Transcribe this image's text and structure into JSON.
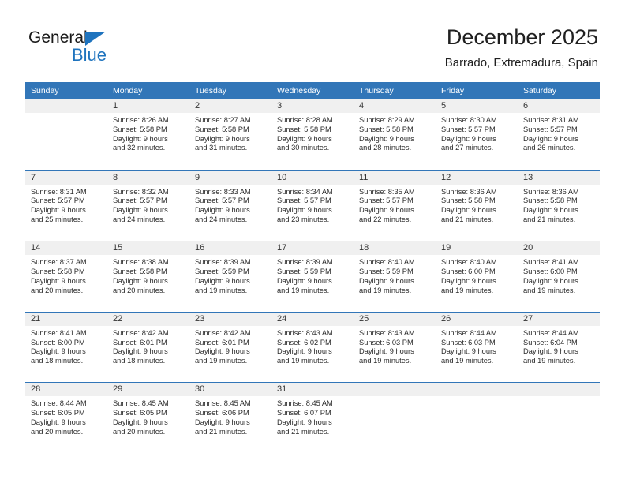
{
  "brand": {
    "name_top": "General",
    "name_bottom": "Blue",
    "accent_color": "#1e73be"
  },
  "header": {
    "title": "December 2025",
    "subtitle": "Barrado, Extremadura, Spain"
  },
  "theme": {
    "header_row_color": "#3276b8",
    "daynum_band_color": "#f0f0f0",
    "text_color": "#2b2b2b"
  },
  "weekdays": [
    "Sunday",
    "Monday",
    "Tuesday",
    "Wednesday",
    "Thursday",
    "Friday",
    "Saturday"
  ],
  "weeks": [
    [
      {
        "day": "",
        "lines": []
      },
      {
        "day": "1",
        "lines": [
          "Sunrise: 8:26 AM",
          "Sunset: 5:58 PM",
          "Daylight: 9 hours",
          "and 32 minutes."
        ]
      },
      {
        "day": "2",
        "lines": [
          "Sunrise: 8:27 AM",
          "Sunset: 5:58 PM",
          "Daylight: 9 hours",
          "and 31 minutes."
        ]
      },
      {
        "day": "3",
        "lines": [
          "Sunrise: 8:28 AM",
          "Sunset: 5:58 PM",
          "Daylight: 9 hours",
          "and 30 minutes."
        ]
      },
      {
        "day": "4",
        "lines": [
          "Sunrise: 8:29 AM",
          "Sunset: 5:58 PM",
          "Daylight: 9 hours",
          "and 28 minutes."
        ]
      },
      {
        "day": "5",
        "lines": [
          "Sunrise: 8:30 AM",
          "Sunset: 5:57 PM",
          "Daylight: 9 hours",
          "and 27 minutes."
        ]
      },
      {
        "day": "6",
        "lines": [
          "Sunrise: 8:31 AM",
          "Sunset: 5:57 PM",
          "Daylight: 9 hours",
          "and 26 minutes."
        ]
      }
    ],
    [
      {
        "day": "7",
        "lines": [
          "Sunrise: 8:31 AM",
          "Sunset: 5:57 PM",
          "Daylight: 9 hours",
          "and 25 minutes."
        ]
      },
      {
        "day": "8",
        "lines": [
          "Sunrise: 8:32 AM",
          "Sunset: 5:57 PM",
          "Daylight: 9 hours",
          "and 24 minutes."
        ]
      },
      {
        "day": "9",
        "lines": [
          "Sunrise: 8:33 AM",
          "Sunset: 5:57 PM",
          "Daylight: 9 hours",
          "and 24 minutes."
        ]
      },
      {
        "day": "10",
        "lines": [
          "Sunrise: 8:34 AM",
          "Sunset: 5:57 PM",
          "Daylight: 9 hours",
          "and 23 minutes."
        ]
      },
      {
        "day": "11",
        "lines": [
          "Sunrise: 8:35 AM",
          "Sunset: 5:57 PM",
          "Daylight: 9 hours",
          "and 22 minutes."
        ]
      },
      {
        "day": "12",
        "lines": [
          "Sunrise: 8:36 AM",
          "Sunset: 5:58 PM",
          "Daylight: 9 hours",
          "and 21 minutes."
        ]
      },
      {
        "day": "13",
        "lines": [
          "Sunrise: 8:36 AM",
          "Sunset: 5:58 PM",
          "Daylight: 9 hours",
          "and 21 minutes."
        ]
      }
    ],
    [
      {
        "day": "14",
        "lines": [
          "Sunrise: 8:37 AM",
          "Sunset: 5:58 PM",
          "Daylight: 9 hours",
          "and 20 minutes."
        ]
      },
      {
        "day": "15",
        "lines": [
          "Sunrise: 8:38 AM",
          "Sunset: 5:58 PM",
          "Daylight: 9 hours",
          "and 20 minutes."
        ]
      },
      {
        "day": "16",
        "lines": [
          "Sunrise: 8:39 AM",
          "Sunset: 5:59 PM",
          "Daylight: 9 hours",
          "and 19 minutes."
        ]
      },
      {
        "day": "17",
        "lines": [
          "Sunrise: 8:39 AM",
          "Sunset: 5:59 PM",
          "Daylight: 9 hours",
          "and 19 minutes."
        ]
      },
      {
        "day": "18",
        "lines": [
          "Sunrise: 8:40 AM",
          "Sunset: 5:59 PM",
          "Daylight: 9 hours",
          "and 19 minutes."
        ]
      },
      {
        "day": "19",
        "lines": [
          "Sunrise: 8:40 AM",
          "Sunset: 6:00 PM",
          "Daylight: 9 hours",
          "and 19 minutes."
        ]
      },
      {
        "day": "20",
        "lines": [
          "Sunrise: 8:41 AM",
          "Sunset: 6:00 PM",
          "Daylight: 9 hours",
          "and 19 minutes."
        ]
      }
    ],
    [
      {
        "day": "21",
        "lines": [
          "Sunrise: 8:41 AM",
          "Sunset: 6:00 PM",
          "Daylight: 9 hours",
          "and 18 minutes."
        ]
      },
      {
        "day": "22",
        "lines": [
          "Sunrise: 8:42 AM",
          "Sunset: 6:01 PM",
          "Daylight: 9 hours",
          "and 18 minutes."
        ]
      },
      {
        "day": "23",
        "lines": [
          "Sunrise: 8:42 AM",
          "Sunset: 6:01 PM",
          "Daylight: 9 hours",
          "and 19 minutes."
        ]
      },
      {
        "day": "24",
        "lines": [
          "Sunrise: 8:43 AM",
          "Sunset: 6:02 PM",
          "Daylight: 9 hours",
          "and 19 minutes."
        ]
      },
      {
        "day": "25",
        "lines": [
          "Sunrise: 8:43 AM",
          "Sunset: 6:03 PM",
          "Daylight: 9 hours",
          "and 19 minutes."
        ]
      },
      {
        "day": "26",
        "lines": [
          "Sunrise: 8:44 AM",
          "Sunset: 6:03 PM",
          "Daylight: 9 hours",
          "and 19 minutes."
        ]
      },
      {
        "day": "27",
        "lines": [
          "Sunrise: 8:44 AM",
          "Sunset: 6:04 PM",
          "Daylight: 9 hours",
          "and 19 minutes."
        ]
      }
    ],
    [
      {
        "day": "28",
        "lines": [
          "Sunrise: 8:44 AM",
          "Sunset: 6:05 PM",
          "Daylight: 9 hours",
          "and 20 minutes."
        ]
      },
      {
        "day": "29",
        "lines": [
          "Sunrise: 8:45 AM",
          "Sunset: 6:05 PM",
          "Daylight: 9 hours",
          "and 20 minutes."
        ]
      },
      {
        "day": "30",
        "lines": [
          "Sunrise: 8:45 AM",
          "Sunset: 6:06 PM",
          "Daylight: 9 hours",
          "and 21 minutes."
        ]
      },
      {
        "day": "31",
        "lines": [
          "Sunrise: 8:45 AM",
          "Sunset: 6:07 PM",
          "Daylight: 9 hours",
          "and 21 minutes."
        ]
      },
      {
        "day": "",
        "lines": []
      },
      {
        "day": "",
        "lines": []
      },
      {
        "day": "",
        "lines": []
      }
    ]
  ]
}
